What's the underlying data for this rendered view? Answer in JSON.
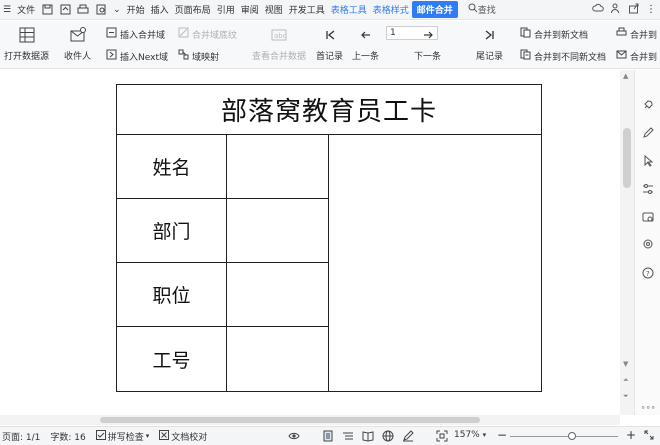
{
  "menubar": {
    "file_label": "文件",
    "tabs": [
      "开始",
      "插入",
      "页面布局",
      "引用",
      "审阅",
      "视图",
      "开发工具"
    ],
    "table_tools": "表格工具",
    "table_style": "表格样式",
    "mail_merge": "邮件合并",
    "search_label": "查找"
  },
  "ribbon": {
    "open_source": "打开数据源",
    "recipient": "收件人",
    "insert_merge_field": "插入合并域",
    "merge_field_shading": "合并域底纹",
    "insert_next_field": "插入Next域",
    "field_mapping": "域映射",
    "view_merged_data": "查看合并数据",
    "first_record": "首记录",
    "prev_record": "上一条",
    "record_number": "1",
    "next_record": "下一条",
    "last_record": "尾记录",
    "merge_new_doc": "合并到新文档",
    "merge_separate_docs": "合并到不同新文档",
    "merge_printer": "合并到",
    "merge_email": "合并到"
  },
  "document": {
    "title": "部落窝教育员工卡",
    "rows": [
      "姓名",
      "部门",
      "职位",
      "工号"
    ]
  },
  "status": {
    "page": "页面: 1/1",
    "word_count": "字数: 16",
    "spell_check": "拼写检查",
    "doc_proof": "文档校对",
    "zoom": "157%"
  },
  "colors": {
    "accent": "#2f7cf6"
  }
}
